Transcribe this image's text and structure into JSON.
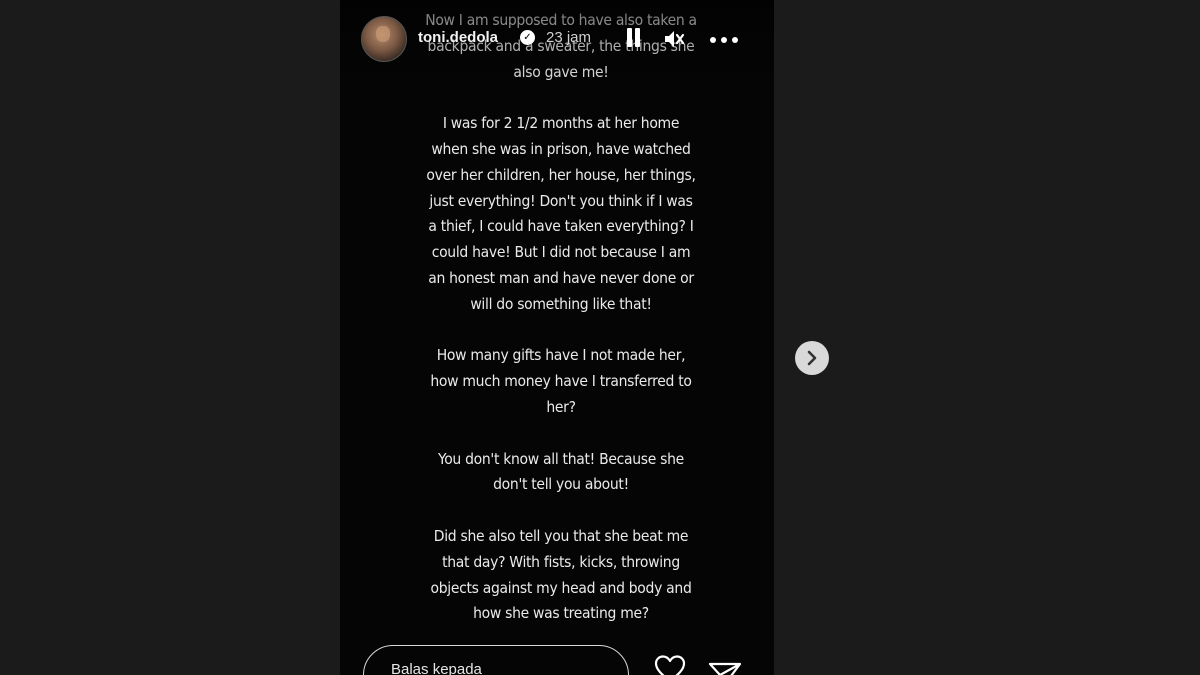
{
  "header": {
    "username": "toni.dedola",
    "verified_icon": "verified-badge-icon",
    "timestamp": "23 jam",
    "pause_icon": "pause-icon",
    "mute_icon": "volume-muted-icon",
    "more_icon": "more-options-icon"
  },
  "story": {
    "paragraphs": [
      "Now I am supposed to have also taken a backpack and a sweater, the things she also gave me!",
      "I was for 2 1/2 months at her home when she was in prison, have watched over her children, her house, her things, just everything! Don't you think if I was a thief, I could have taken everything? I could have! But I did not because I am an honest man and have never done or will do something like that!",
      "How many gifts have I not made her, how much money have I transferred to her?",
      "You don't know all that! Because she don't tell you about!",
      "Did she also tell you that she beat me that day? With fists, kicks, throwing objects against my head and body and how she was treating me?"
    ]
  },
  "footer": {
    "reply_placeholder": "Balas kepada",
    "like_icon": "heart-icon",
    "share_icon": "send-icon"
  },
  "navigation": {
    "next_icon": "chevron-right-icon"
  },
  "colors": {
    "page_background": "#1b1b1b",
    "story_background": "#050505",
    "text": "#eaeaea",
    "next_button": "#d9d9d9"
  }
}
